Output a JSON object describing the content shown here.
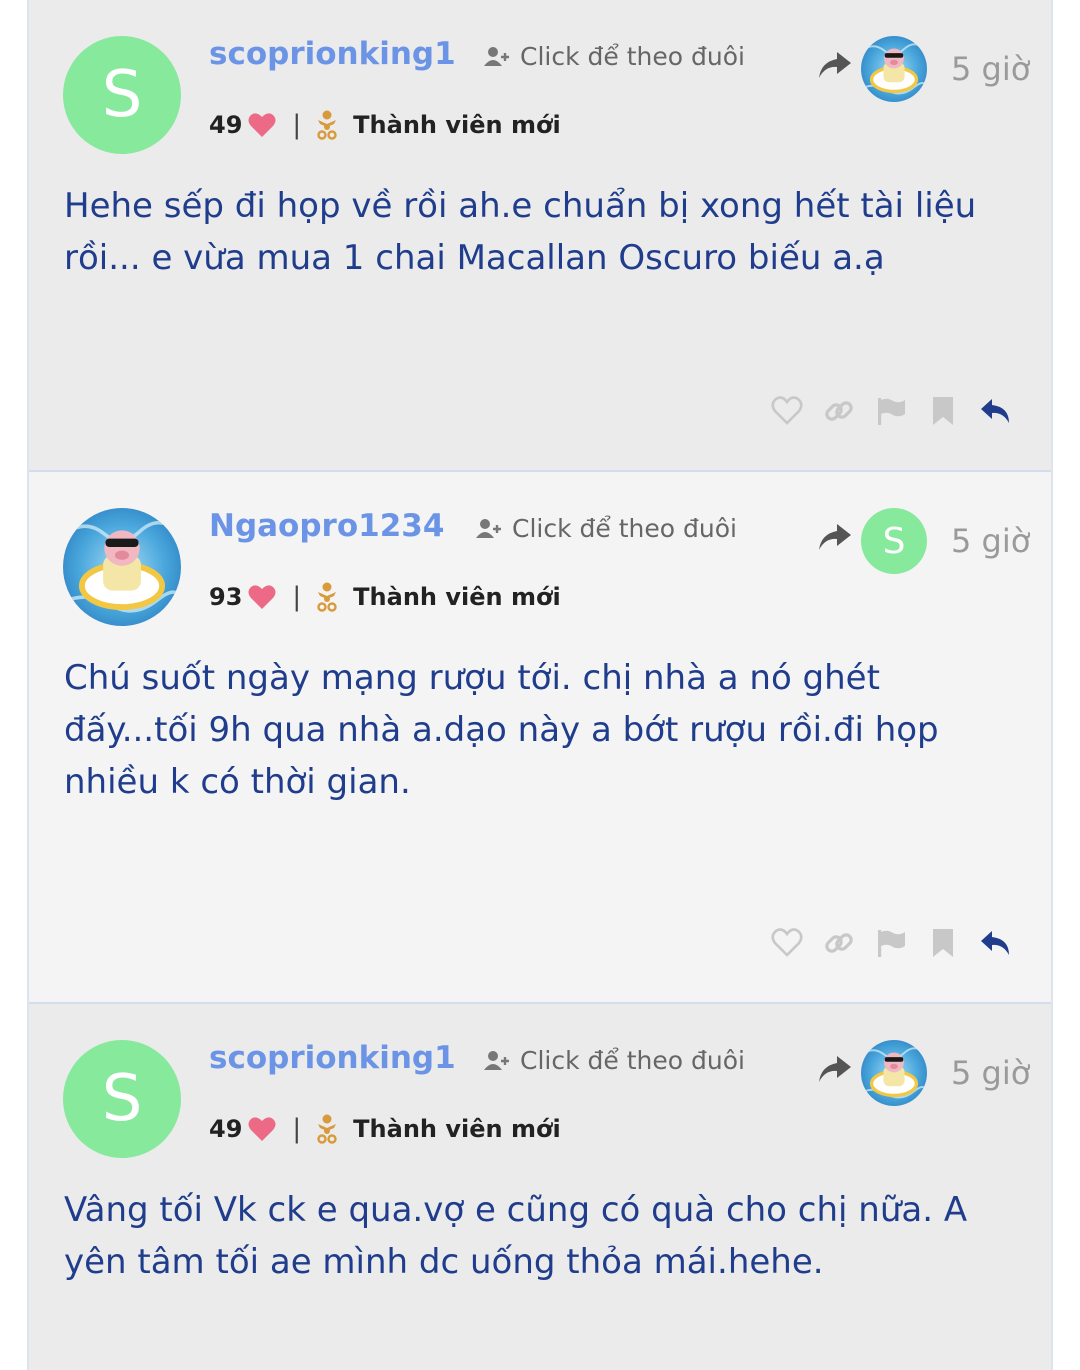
{
  "posts": [
    {
      "username": "scoprionking1",
      "follow_label": "Click để theo đuôi",
      "time": "5 giờ",
      "avatar_letter": "S",
      "reply_avatar": "pig-float-avatar",
      "likes": "49",
      "role": "Thành viên mới",
      "content": "Hehe sếp đi họp về rồi ah.e chuẩn bị xong hết tài liệu rồi... e vừa mua 1 chai Macallan Oscuro biếu a.ạ"
    },
    {
      "username": "Ngaopro1234",
      "follow_label": "Click để theo đuôi",
      "time": "5 giờ",
      "avatar": "pig-float-avatar",
      "reply_avatar_letter": "S",
      "likes": "93",
      "role": "Thành viên mới",
      "content": "Chú suốt ngày mạng rượu tới. chị nhà a nó ghét đấy...tối 9h qua nhà a.dạo này a bớt rượu rồi.đi họp nhiều k có thời gian."
    },
    {
      "username": "scoprionking1",
      "follow_label": "Click để theo đuôi",
      "time": "5 giờ",
      "avatar_letter": "S",
      "reply_avatar": "pig-float-avatar",
      "likes": "49",
      "role": "Thành viên mới",
      "content": "Vâng tối Vk ck e qua.vợ e cũng có quà cho chị nữa. A yên tâm tối ae mình dc uống thỏa mái.hehe."
    }
  ],
  "colors": {
    "username": "#6b94e6",
    "content": "#1f3d8c",
    "avatar_bg": "#86e99c",
    "heart": "#ec6a86",
    "reply_icon": "#1f3d8c"
  },
  "icons": [
    "follow-user-icon",
    "share-arrow-icon",
    "heart-icon",
    "baby-badge-icon",
    "like-icon",
    "link-icon",
    "flag-icon",
    "bookmark-icon",
    "reply-icon"
  ]
}
